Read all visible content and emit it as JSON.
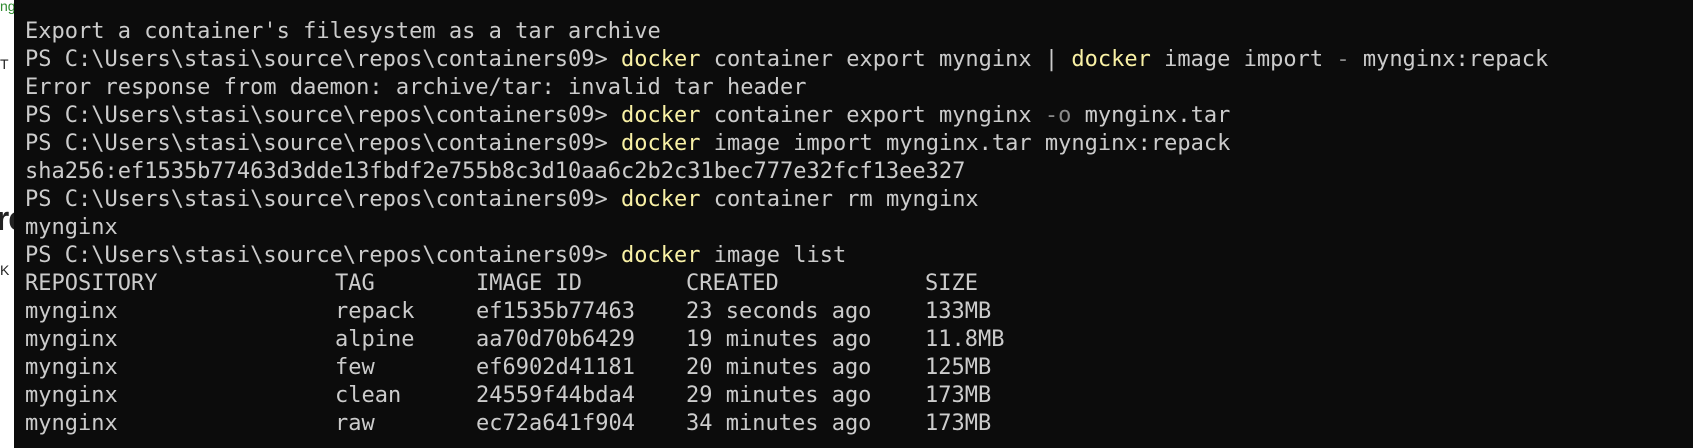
{
  "background": {
    "fragments": [
      "ng",
      "re",
      "K"
    ]
  },
  "terminal": {
    "prompt": "PS C:\\Users\\stasi\\source\\repos\\containers09>",
    "lines": {
      "help_text": "Export a container's filesystem as a tar archive",
      "cmd1_a": "docker",
      "cmd1_b": " container export mynginx | ",
      "cmd1_c": "docker",
      "cmd1_d": " image import ",
      "cmd1_e": "-",
      "cmd1_f": " mynginx:repack",
      "error": "Error response from daemon: archive/tar: invalid tar header",
      "cmd2_a": "docker",
      "cmd2_b": " container export mynginx ",
      "cmd2_c": "-o",
      "cmd2_d": " mynginx.tar",
      "cmd3_a": "docker",
      "cmd3_b": " image import mynginx.tar mynginx:repack",
      "sha": "sha256:ef1535b77463d3dde13fbdf2e755b8c3d10aa6c2b2c31bec777e32fcf13ee327",
      "cmd4_a": "docker",
      "cmd4_b": " container rm mynginx",
      "rm_output": "mynginx",
      "cmd5_a": "docker",
      "cmd5_b": " image list"
    },
    "table": {
      "headers": [
        "REPOSITORY",
        "TAG",
        "IMAGE ID",
        "CREATED",
        "SIZE"
      ],
      "rows": [
        [
          "mynginx",
          "repack",
          "ef1535b77463",
          "23 seconds ago",
          "133MB"
        ],
        [
          "mynginx",
          "alpine",
          "aa70d70b6429",
          "19 minutes ago",
          "11.8MB"
        ],
        [
          "mynginx",
          "few",
          "ef6902d41181",
          "20 minutes ago",
          "125MB"
        ],
        [
          "mynginx",
          "clean",
          "24559f44bda4",
          "29 minutes ago",
          "173MB"
        ],
        [
          "mynginx",
          "raw",
          "ec72a641f904",
          "34 minutes ago",
          "173MB"
        ]
      ]
    }
  },
  "colors": {
    "terminal_bg": "#0c0c0c",
    "text": "#cccccc",
    "command": "#f9f1a5",
    "flag": "#8a8a8a"
  }
}
